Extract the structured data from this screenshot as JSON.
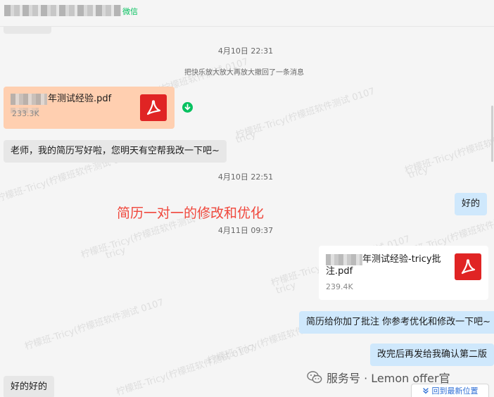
{
  "header": {
    "contact_suffix": "微信"
  },
  "timestamps": {
    "t1": "4月10日 22:31",
    "t2": "4月10日 22:51",
    "t3": "4月11日 09:37"
  },
  "system_message": "把快乐放大放大再放大撤回了一条消息",
  "file_received": {
    "name": "年测试经验.pdf",
    "size": "233.3K"
  },
  "file_sent": {
    "name_line1": "年测试经验-tricy批",
    "name_line2": "注.pdf",
    "size": "239.4K"
  },
  "messages": {
    "m1": "老师，我的简历写好啦，您明天有空帮我改一下吧~",
    "m2": "好的",
    "m3": "简历给你加了批注 你参考优化和修改一下吧~",
    "m4": "改完后再发给我确认第二版",
    "m5": "好的好的"
  },
  "promo_text": "简历一对一的修改和优化",
  "watermark_text": "柠檬班-Tricy(柠檬班软件测试 0107",
  "watermark_short": "tricy",
  "brand": {
    "text": "服务号 · Lemon offer官"
  },
  "jump_button": {
    "label": "回到最新位置",
    "icon": "chevron-double-down-icon"
  },
  "colors": {
    "accent_green": "#07c160",
    "pdf_red": "#e02424",
    "promo_red": "#f0473c",
    "link_blue": "#2f6fd6"
  }
}
